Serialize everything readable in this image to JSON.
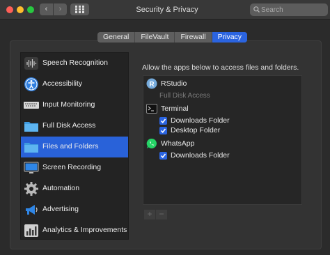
{
  "window": {
    "title": "Security & Privacy",
    "search_placeholder": "Search",
    "back_glyph": "‹",
    "forward_glyph": "›"
  },
  "tabs": [
    {
      "label": "General",
      "active": false
    },
    {
      "label": "FileVault",
      "active": false
    },
    {
      "label": "Firewall",
      "active": false
    },
    {
      "label": "Privacy",
      "active": true
    }
  ],
  "sidebar": {
    "items": [
      {
        "label": "Speech Recognition",
        "icon": "waveform-icon",
        "selected": false
      },
      {
        "label": "Accessibility",
        "icon": "accessibility-icon",
        "selected": false
      },
      {
        "label": "Input Monitoring",
        "icon": "keyboard-icon",
        "selected": false
      },
      {
        "label": "Full Disk Access",
        "icon": "folder-icon",
        "selected": false
      },
      {
        "label": "Files and Folders",
        "icon": "folder-icon",
        "selected": true
      },
      {
        "label": "Screen Recording",
        "icon": "monitor-icon",
        "selected": false
      },
      {
        "label": "Automation",
        "icon": "gear-icon",
        "selected": false
      },
      {
        "label": "Advertising",
        "icon": "megaphone-icon",
        "selected": false
      },
      {
        "label": "Analytics & Improvements",
        "icon": "chart-icon",
        "selected": false
      }
    ]
  },
  "panel": {
    "heading": "Allow the apps below to access files and folders.",
    "apps": [
      {
        "name": "RStudio",
        "icon": "rstudio-icon",
        "subtitle": "Full Disk Access",
        "permissions": []
      },
      {
        "name": "Terminal",
        "icon": "terminal-icon",
        "permissions": [
          {
            "label": "Downloads Folder",
            "checked": true
          },
          {
            "label": "Desktop Folder",
            "checked": true
          }
        ]
      },
      {
        "name": "WhatsApp",
        "icon": "whatsapp-icon",
        "permissions": [
          {
            "label": "Downloads Folder",
            "checked": true
          }
        ]
      }
    ],
    "add_label": "+",
    "remove_label": "−"
  },
  "colors": {
    "accent": "#2b64e0",
    "selection": "#2962d9",
    "folder": "#4aa7e8",
    "whatsapp": "#25d366"
  }
}
